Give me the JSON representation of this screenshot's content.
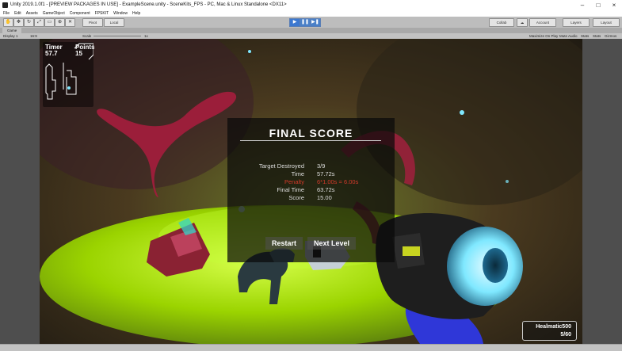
{
  "window": {
    "title": "Unity 2019.1.0f1 - [PREVIEW PACKAGES IN USE] - ExampleScene.unity - SceneKits_FPS - PC, Mac & Linux Standalone <DX11>"
  },
  "menu": [
    "File",
    "Edit",
    "Assets",
    "GameObject",
    "Component",
    "FPSKIT",
    "Window",
    "Help"
  ],
  "toolbar": {
    "pivot_label": "Pivot",
    "local_label": "Local",
    "collab_label": "Collab",
    "account_label": "Account",
    "layers_label": "Layers",
    "layout_label": "Layout"
  },
  "game_tab": {
    "label": "Game"
  },
  "game_toolbar": {
    "display": "Display 1",
    "aspect": "16:9",
    "scale_label": "Scale",
    "scale_value": "1x",
    "maximize": "Maximize On Play",
    "mute": "Mute Audio",
    "stats": "Stats",
    "stats2": "Stats",
    "gizmos": "Gizmos"
  },
  "hud": {
    "timer_label": "Timer",
    "timer_value": "57.7",
    "points_label": "Points",
    "points_value": "15",
    "weapon_name": "Healmatic500",
    "ammo": "5/60"
  },
  "score_panel": {
    "title": "FINAL SCORE",
    "rows": [
      {
        "label": "Target Destroyed",
        "value": "3/9"
      },
      {
        "label": "Time",
        "value": "57.72s"
      },
      {
        "label": "Penalty",
        "value": "6*1.00s = 6.00s"
      },
      {
        "label": "Final Time",
        "value": "63.72s"
      },
      {
        "label": "Score",
        "value": "15.00"
      }
    ],
    "restart_label": "Restart",
    "next_level_label": "Next Level"
  },
  "colors": {
    "penalty": "#d23a2a",
    "slime_green": "#a6e000",
    "scope_cyan": "#7fe8ff"
  }
}
